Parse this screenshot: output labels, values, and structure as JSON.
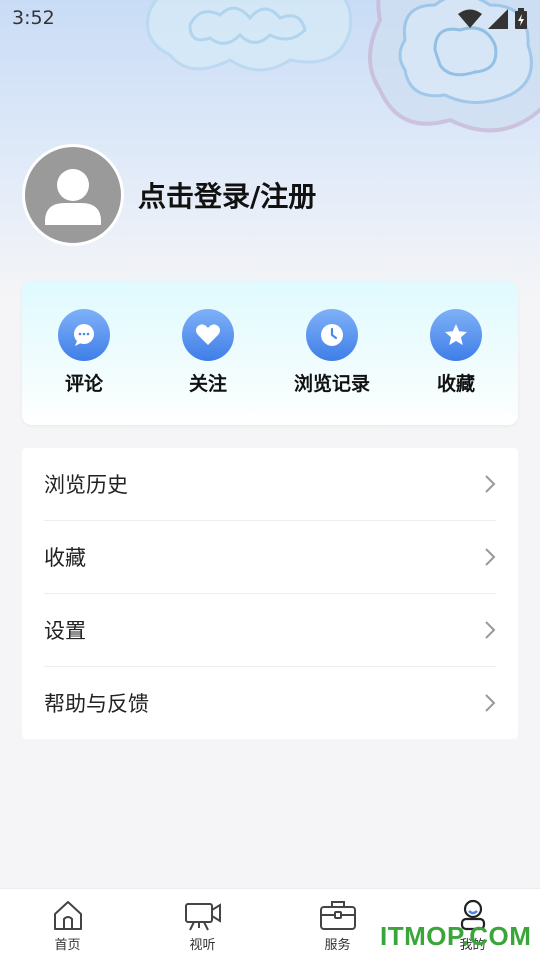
{
  "status_bar": {
    "time": "3:52",
    "icons": [
      "wifi-icon",
      "signal-icon",
      "battery-icon"
    ]
  },
  "profile": {
    "login_text": "点击登录/注册",
    "avatar_icon": "user-avatar-icon"
  },
  "quick_actions": [
    {
      "label": "评论",
      "icon": "comment-icon"
    },
    {
      "label": "关注",
      "icon": "heart-icon"
    },
    {
      "label": "浏览记录",
      "icon": "clock-icon"
    },
    {
      "label": "收藏",
      "icon": "star-icon"
    }
  ],
  "menu": [
    {
      "label": "浏览历史"
    },
    {
      "label": "收藏"
    },
    {
      "label": "设置"
    },
    {
      "label": "帮助与反馈"
    }
  ],
  "tabbar": [
    {
      "label": "首页",
      "icon": "home-icon"
    },
    {
      "label": "视听",
      "icon": "video-camera-icon"
    },
    {
      "label": "服务",
      "icon": "briefcase-icon"
    },
    {
      "label": "我的",
      "icon": "profile-icon"
    }
  ],
  "watermark": "ITMOP.COM",
  "colors": {
    "accent_blue": "#4a88ee",
    "watermark_green": "#3aa53a"
  }
}
